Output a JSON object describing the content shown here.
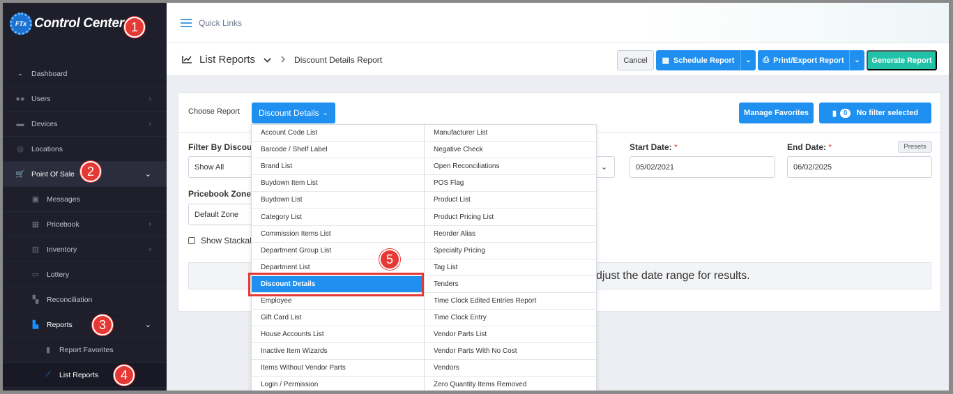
{
  "brand": {
    "logo_text": "FTx",
    "name": "Control Center"
  },
  "sidebar": {
    "items": [
      {
        "label": "Dashboard",
        "icon": "dashboard-icon"
      },
      {
        "label": "Users",
        "icon": "users-icon"
      },
      {
        "label": "Devices",
        "icon": "devices-icon"
      },
      {
        "label": "Locations",
        "icon": "location-pin-icon"
      },
      {
        "label": "Point Of Sale",
        "icon": "cart-icon"
      },
      {
        "label": "Messages",
        "icon": "messages-icon"
      },
      {
        "label": "Pricebook",
        "icon": "calculator-icon"
      },
      {
        "label": "Inventory",
        "icon": "inventory-icon"
      },
      {
        "label": "Lottery",
        "icon": "lottery-icon"
      },
      {
        "label": "Reconciliation",
        "icon": "grid-icon"
      },
      {
        "label": "Reports",
        "icon": "bar-chart-icon"
      },
      {
        "label": "Report Favorites",
        "icon": "bookmark-icon"
      },
      {
        "label": "List Reports",
        "icon": "line-chart-icon"
      }
    ]
  },
  "badges": [
    "1",
    "2",
    "3",
    "4",
    "5"
  ],
  "topbar": {
    "quick_links": "Quick Links"
  },
  "header": {
    "title": "List Reports",
    "current": "Discount Details Report",
    "cancel": "Cancel",
    "schedule": "Schedule Report",
    "print_export": "Print/Export Report",
    "generate": "Generate Report"
  },
  "form": {
    "choose_report_label": "Choose Report",
    "selected_report": "Discount Details",
    "manage_favorites": "Manage Favorites",
    "filter_count": "0",
    "filter_text": "No filter selected",
    "filter_by_label": "Filter By Discou",
    "filter_by_value": "Show All",
    "start_date_label": "Start Date:",
    "start_date_value": "05/02/2021",
    "end_date_label": "End Date:",
    "end_date_value": "06/02/2025",
    "presets": "Presets",
    "pricebook_zone_label": "Pricebook Zone:",
    "pricebook_zone_value": "Default Zone",
    "show_stackable": "Show Stackab",
    "notice": "djust the date range for results."
  },
  "menu": {
    "left": [
      "Account Code List",
      "Barcode / Shelf Label",
      "Brand List",
      "Buydown Item List",
      "Buydown List",
      "Category List",
      "Commission Items List",
      "Department Group List",
      "Department List",
      "Discount Details",
      "Employee",
      "Gift Card List",
      "House Accounts List",
      "Inactive Item Wizards",
      "Items Without Vendor Parts",
      "Login / Permission"
    ],
    "right": [
      "Manufacturer List",
      "Negative Check",
      "Open Reconciliations",
      "POS Flag",
      "Product List",
      "Product Pricing List",
      "Reorder Alias",
      "Specialty Pricing",
      "Tag List",
      "Tenders",
      "Time Clock Edited Entries Report",
      "Time Clock Entry",
      "Vendor Parts List",
      "Vendor Parts With No Cost",
      "Vendors",
      "Zero Quantity Items Removed"
    ],
    "selected": "Discount Details"
  },
  "colors": {
    "primary": "#1f8ff0",
    "success": "#21c3a8",
    "sidebar": "#1e1f2b",
    "annotation": "#e53935"
  }
}
